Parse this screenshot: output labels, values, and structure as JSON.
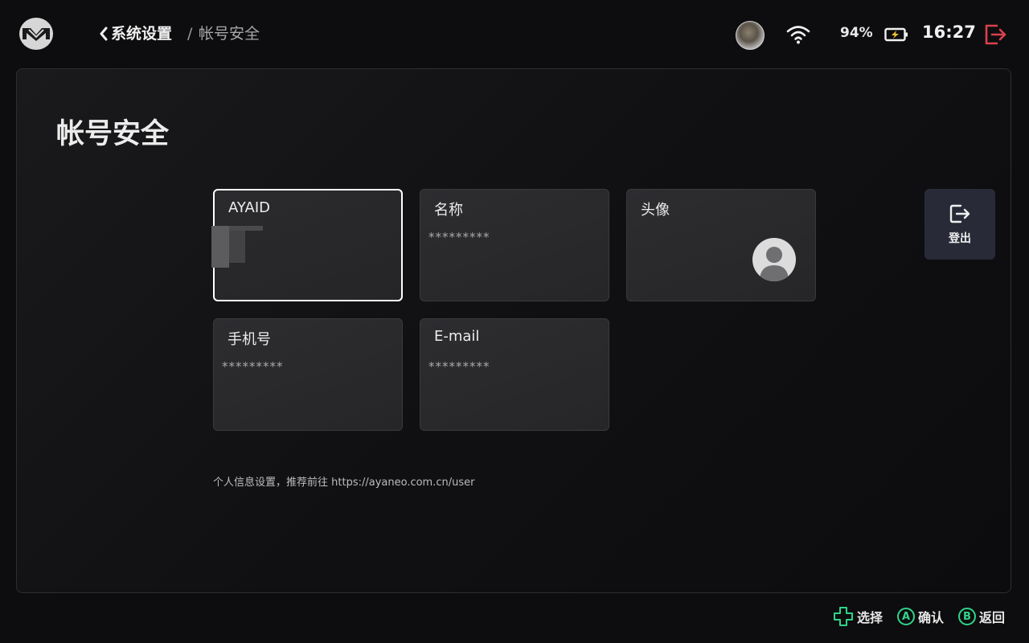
{
  "header": {
    "back_label": "系统设置",
    "separator": "/",
    "current": "帐号安全",
    "battery_percent": "94%",
    "time": "16:27",
    "icons": {
      "logo": "ayaneo-logo-icon",
      "wifi": "wifi-icon",
      "battery": "battery-charging-icon",
      "exit": "exit-icon"
    },
    "colors": {
      "exit": "#d9414b"
    }
  },
  "page": {
    "title": "帐号安全"
  },
  "cards": {
    "ayaid": {
      "label": "AYAID",
      "value": ""
    },
    "name": {
      "label": "名称",
      "value": "*********"
    },
    "avatar": {
      "label": "头像"
    },
    "phone": {
      "label": "手机号",
      "value": "*********"
    },
    "email": {
      "label": "E-mail",
      "value": "*********"
    }
  },
  "logout": {
    "label": "登出",
    "icon": "logout-icon"
  },
  "footnote": "个人信息设置，推荐前往 https://ayaneo.com.cn/user",
  "footer": {
    "select_label": "选择",
    "confirm_key": "A",
    "confirm_label": "确认",
    "back_key": "B",
    "back_label": "返回",
    "accent": "#2fd48a"
  }
}
